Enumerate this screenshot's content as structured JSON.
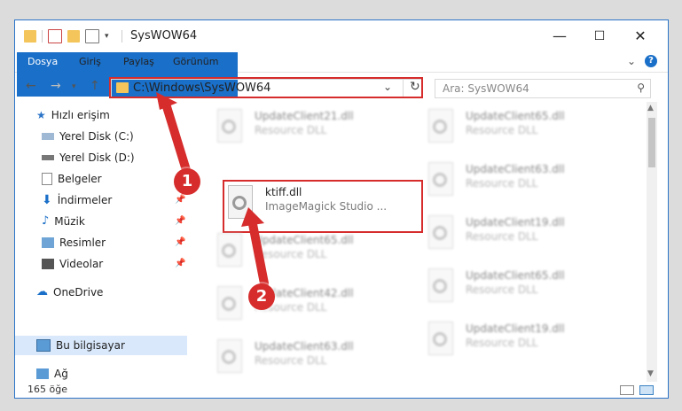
{
  "window": {
    "title": "SysWOW64",
    "controls": {
      "minimize": "—",
      "maximize": "☐",
      "close": "✕"
    }
  },
  "ribbon": {
    "tabs": [
      "Dosya",
      "Giriş",
      "Paylaş",
      "Görünüm"
    ],
    "help": "?"
  },
  "address_bar": {
    "path": "C:\\Windows\\SysWOW64",
    "search_placeholder": "Ara: SysWOW64"
  },
  "sidebar": {
    "items": [
      {
        "label": "Hızlı erişim",
        "icon": "star-icon"
      },
      {
        "label": "Yerel Disk (C:)",
        "icon": "drive-icon"
      },
      {
        "label": "Yerel Disk (D:)",
        "icon": "drive-icon"
      },
      {
        "label": "Belgeler",
        "icon": "document-icon"
      },
      {
        "label": "İndirmeler",
        "icon": "download-icon"
      },
      {
        "label": "Müzik",
        "icon": "music-icon"
      },
      {
        "label": "Resimler",
        "icon": "pictures-icon"
      },
      {
        "label": "Videolar",
        "icon": "video-icon"
      },
      {
        "label": "OneDrive",
        "icon": "cloud-icon"
      },
      {
        "label": "Bu bilgisayar",
        "icon": "computer-icon"
      },
      {
        "label": "Ağ",
        "icon": "network-icon"
      }
    ]
  },
  "files": {
    "highlighted": {
      "name": "ktiff.dll",
      "desc": "ImageMagick Studio ..."
    },
    "left_column": [
      {
        "name": "UpdateClient21.dll",
        "desc": "Resource DLL"
      },
      {
        "name": "UpdateClient65.dll",
        "desc": "Resource DLL"
      },
      {
        "name": "UpdateClient42.dll",
        "desc": "Resource DLL"
      },
      {
        "name": "UpdateClient63.dll",
        "desc": "Resource DLL"
      }
    ],
    "right_column": [
      {
        "name": "UpdateClient65.dll",
        "desc": "Resource DLL"
      },
      {
        "name": "UpdateClient63.dll",
        "desc": "Resource DLL"
      },
      {
        "name": "UpdateClient19.dll",
        "desc": "Resource DLL"
      },
      {
        "name": "UpdateClient65.dll",
        "desc": "Resource DLL"
      },
      {
        "name": "UpdateClient19.dll",
        "desc": "Resource DLL"
      }
    ]
  },
  "status": {
    "count": "165 öğe"
  },
  "annotations": {
    "step1": "1",
    "step2": "2"
  },
  "colors": {
    "accent": "#1a6fc8",
    "highlight_red": "#d62c2c"
  }
}
